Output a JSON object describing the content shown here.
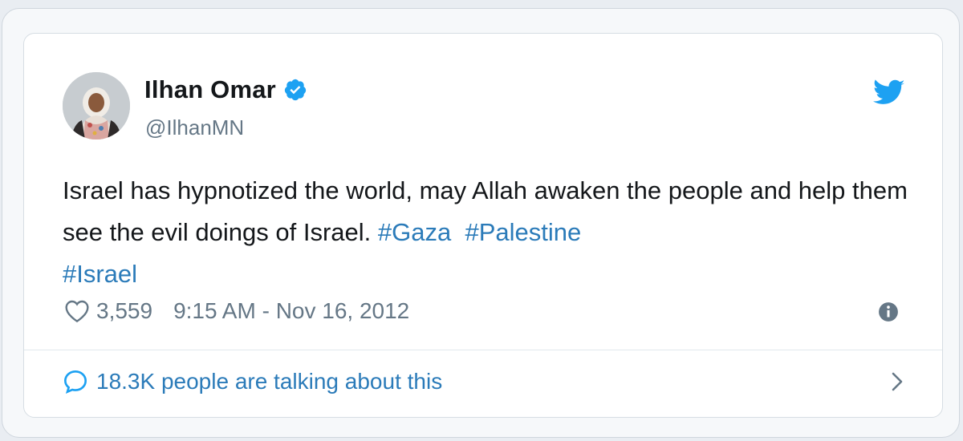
{
  "author": {
    "name": "Ilhan Omar",
    "handle": "@IlhanMN",
    "verified": true,
    "avatar_icon": "user-avatar-photo"
  },
  "tweet": {
    "text_main": "Israel has hypnotized the world, may Allah awaken the people and help them see the evil doings of Israel.",
    "hashtags": [
      "#Gaza",
      "#Palestine",
      "#Israel"
    ]
  },
  "meta": {
    "like_count": "3,559",
    "timestamp": "9:15 AM - Nov 16, 2012"
  },
  "footer": {
    "talking_text": "18.3K people are talking about this"
  },
  "icons": {
    "verified": "verified-badge-icon",
    "brand": "twitter-bird-icon",
    "like": "heart-icon",
    "info": "info-icon",
    "reply": "reply-bubble-icon",
    "more": "chevron-right-icon"
  },
  "colors": {
    "accent": "#1da1f2",
    "link": "#2b7bb9",
    "text": "#14171a",
    "muted": "#657786"
  }
}
